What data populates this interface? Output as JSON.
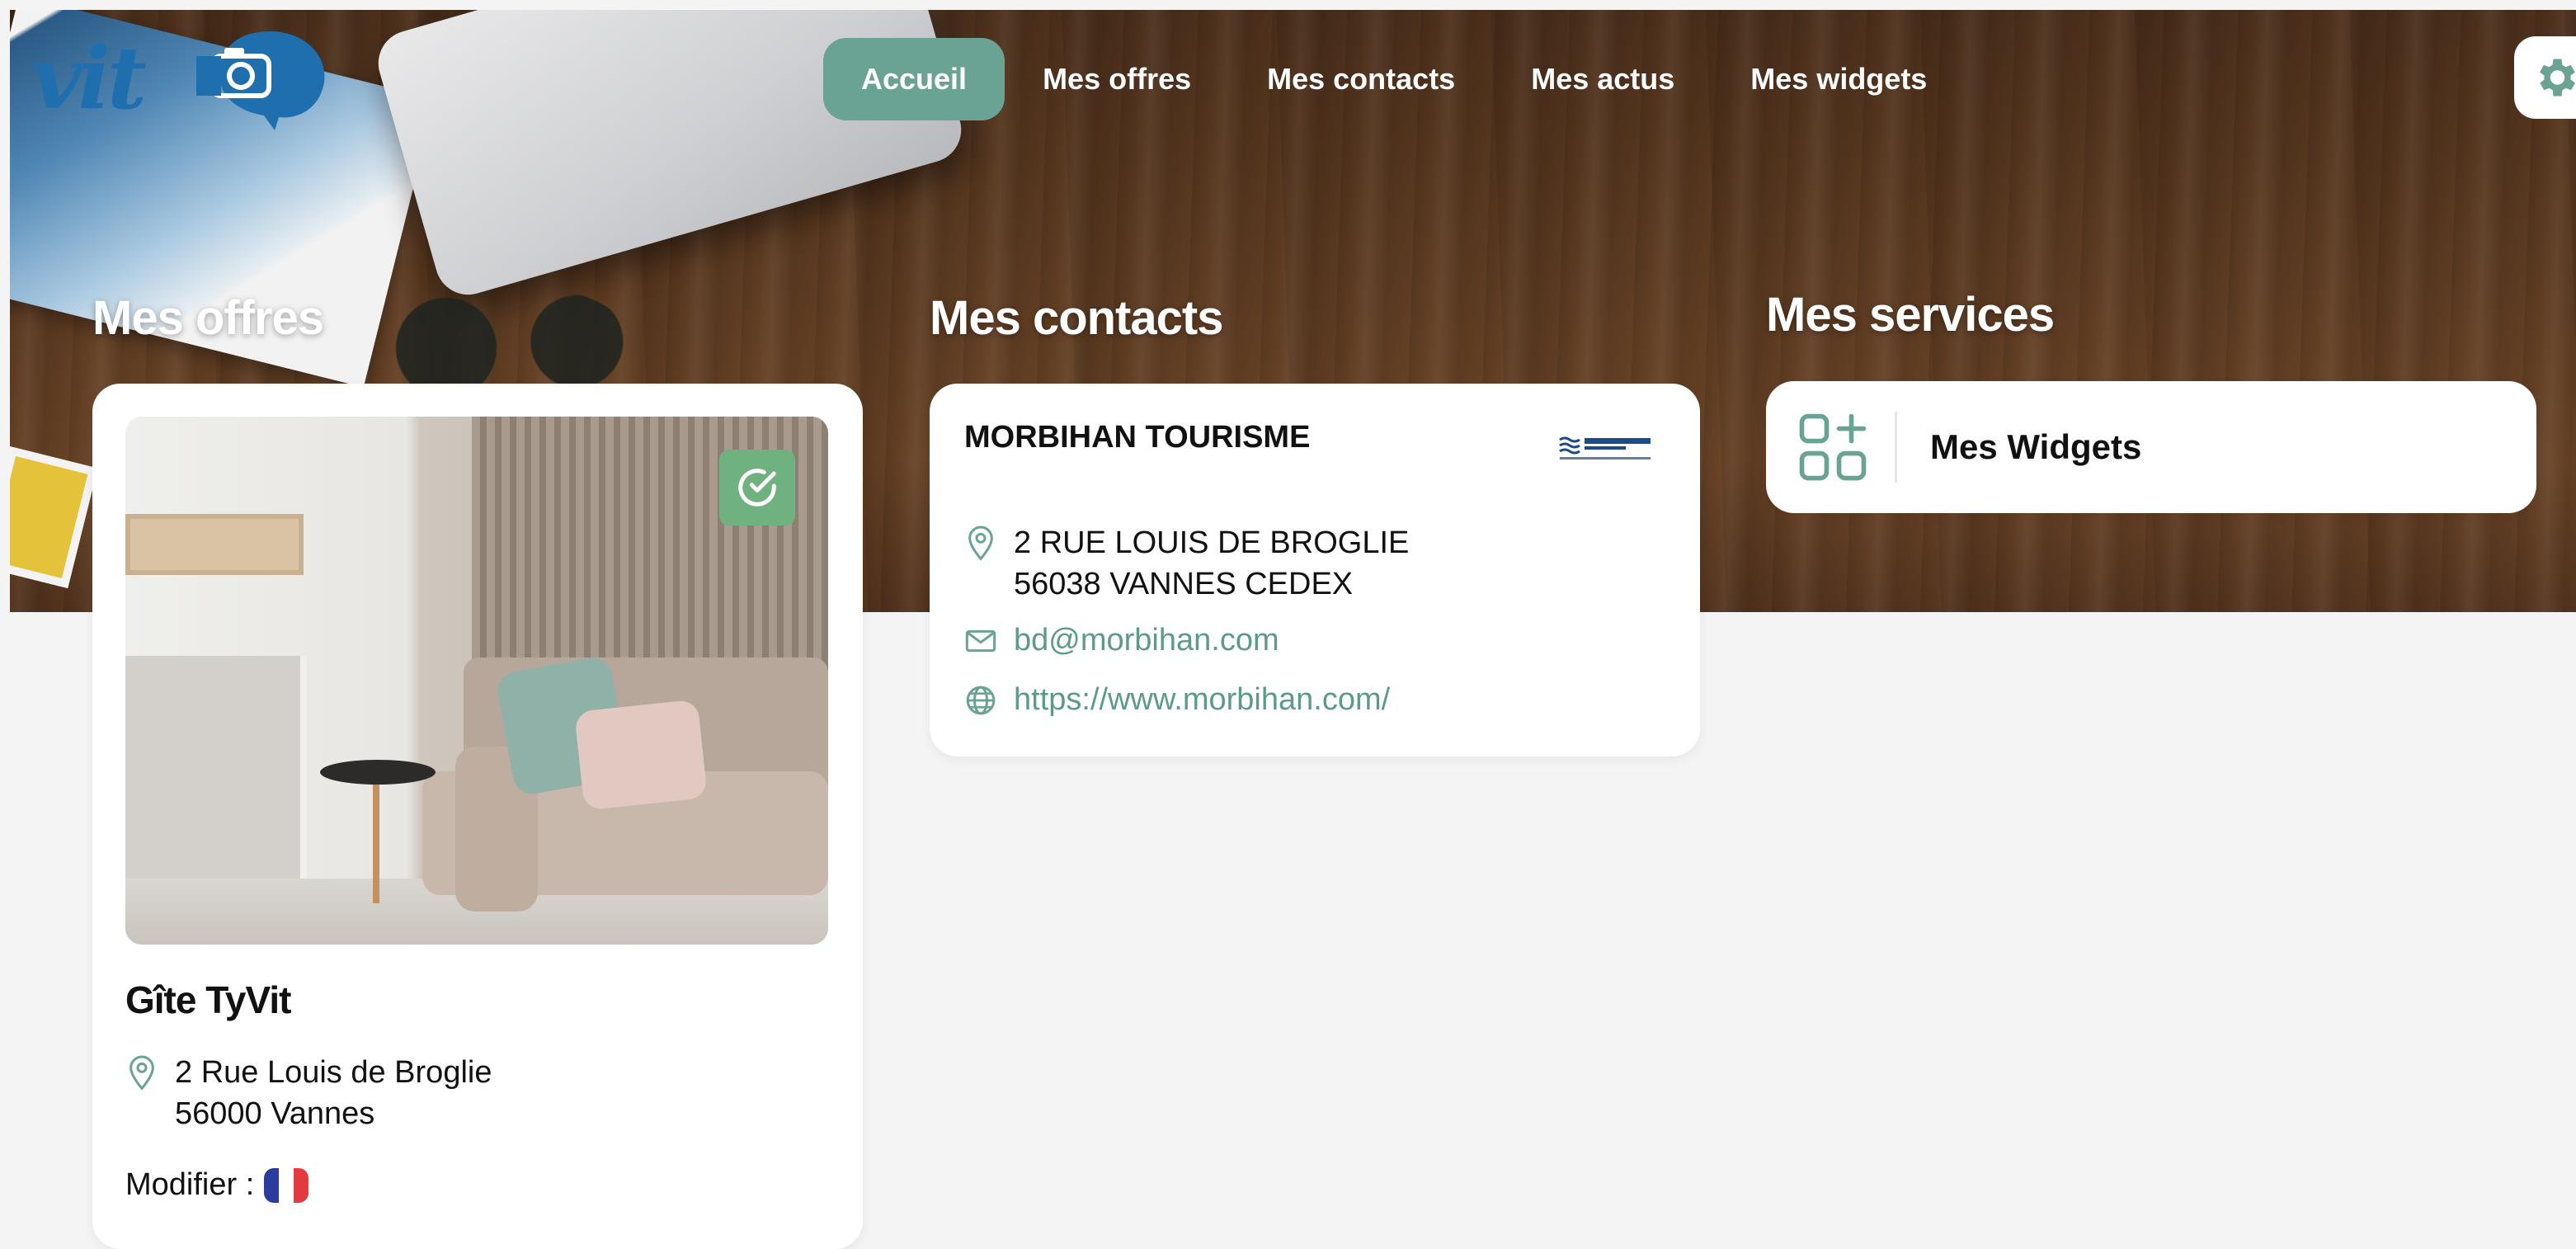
{
  "app": {
    "logo_text": "vit"
  },
  "nav": {
    "items": [
      {
        "label": "Accueil",
        "active": true
      },
      {
        "label": "Mes offres",
        "active": false
      },
      {
        "label": "Mes contacts",
        "active": false
      },
      {
        "label": "Mes actus",
        "active": false
      },
      {
        "label": "Mes widgets",
        "active": false
      }
    ]
  },
  "sections": {
    "offers_title": "Mes offres",
    "contacts_title": "Mes contacts",
    "services_title": "Mes services"
  },
  "offer": {
    "name": "Gîte TyVit",
    "address_line1": "2 Rue Louis de Broglie",
    "address_line2": "56000 Vannes",
    "modify_label": "Modifier :"
  },
  "contact": {
    "name": "MORBIHAN TOURISME",
    "address_line1": "2 RUE LOUIS DE BROGLIE",
    "address_line2": "56038 VANNES CEDEX",
    "email": "bd@morbihan.com",
    "website": "https://www.morbihan.com/"
  },
  "services": {
    "widgets_label": "Mes Widgets"
  },
  "colors": {
    "accent": "#6aa394",
    "link": "#5c9a8a",
    "logo_blue": "#1f6fae",
    "badge_green": "#6fb27f"
  }
}
